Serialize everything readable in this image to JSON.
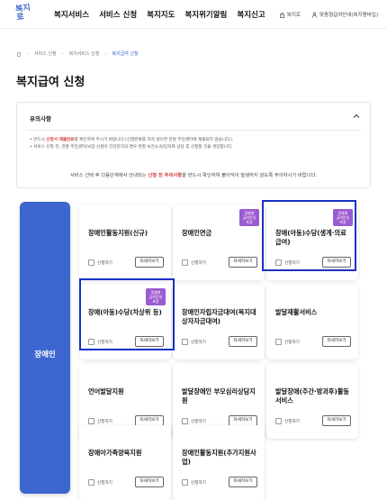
{
  "header": {
    "logo_line1": "복지",
    "logo_line2": "로",
    "nav": [
      "복지서비스",
      "서비스 신청",
      "복지지도",
      "복지위기알림",
      "복지신고"
    ],
    "utils": [
      "복지로",
      "맞춤형급여안내(복지멤버십)"
    ]
  },
  "breadcrumb": [
    "서비스 신청",
    "복지서비스 신청",
    "복지급여 신청"
  ],
  "page_title": "복지급여 신청",
  "notice": {
    "heading": "유의사항",
    "line1_pre": "• 반드시 ",
    "line1_hl": "신청서 제출완료",
    "line1_post": "를 확인하여 주시기 바랍니다.(신청완료를 하지 않으면 관할 주민센터에 제출되지 않습니다.)",
    "line2": "• 서비스 신청 전, 관할 주민센터(보장·신생아 건강관리의 경우 관할 보건소)담당자와 상담 후 신청할 것을 권장합니다.",
    "foot_pre": "서비스 선택 후 다음단계에서 안내되는 ",
    "foot_hl": "신청 전 주의사항",
    "foot_post": "을 반드시 확인하여 불이익이 발생하지 않도록 주의하시기 바랍니다."
  },
  "category": "장애인",
  "checkbox_label": "신청하기",
  "detail_label": "자세히보기",
  "badge": [
    "맞춤형",
    "급여안내",
    "포함"
  ],
  "cards": [
    {
      "title": "장애인활동지원(신규)",
      "badge": false
    },
    {
      "title": "장애인연금",
      "badge": true
    },
    {
      "title": "장애(아동)수당(생계·의료급여)",
      "badge": true
    },
    {
      "title": "장애(아동)수당(차상위 등)",
      "badge": true
    },
    {
      "title": "장애인자립자금대여(복지대상자자금대여)",
      "badge": false
    },
    {
      "title": "발달재활서비스",
      "badge": false
    },
    {
      "title": "언어발달지원",
      "badge": false
    },
    {
      "title": "발달장애인 부모심리상담지원",
      "badge": false
    },
    {
      "title": "발달장애(주간·방과후)활동서비스",
      "badge": false
    },
    {
      "title": "장애아가족양육지원",
      "badge": false
    },
    {
      "title": "장애인활동지원(추가지원사업)",
      "badge": false
    }
  ]
}
